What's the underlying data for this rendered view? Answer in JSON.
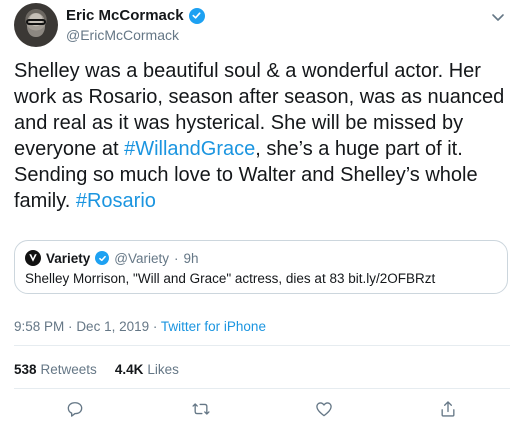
{
  "author": {
    "name": "Eric McCormack",
    "handle": "@EricMcCormack",
    "avatar_icon": "avatar"
  },
  "tweet": {
    "line1": "Shelley was a beautiful soul & a wonderful actor. Her",
    "line2": "work as Rosario, season after season, was as nuanced",
    "line3": "and real as it was hysterical. She will be missed by",
    "line4_pre": "everyone at ",
    "line4_tag": "#WillandGrace",
    "line4_post": ", she’s a huge part of it.",
    "line5": "Sending so much love to Walter and Shelley’s whole",
    "line6_pre": "family. ",
    "line6_tag": "#Rosario"
  },
  "quote": {
    "name": "Variety",
    "handle": "@Variety",
    "separator": "·",
    "time": "9h",
    "text": "Shelley Morrison, \"Will and Grace\" actress, dies at 83 bit.ly/2OFBRzt"
  },
  "meta": {
    "time": "9:58 PM",
    "separator1": "·",
    "date": "Dec 1, 2019",
    "separator2": "·",
    "source": "Twitter for iPhone"
  },
  "stats": {
    "retweets_count": "538",
    "retweets_label": "Retweets",
    "likes_count": "4.4K",
    "likes_label": "Likes"
  },
  "colors": {
    "link": "#1b95e0",
    "verified": "#1da1f2",
    "muted": "#657786",
    "divider": "#e6ecf0"
  },
  "icons": [
    "verified-badge-icon",
    "chevron-down-icon",
    "reply-icon",
    "retweet-icon",
    "like-icon",
    "share-icon"
  ]
}
